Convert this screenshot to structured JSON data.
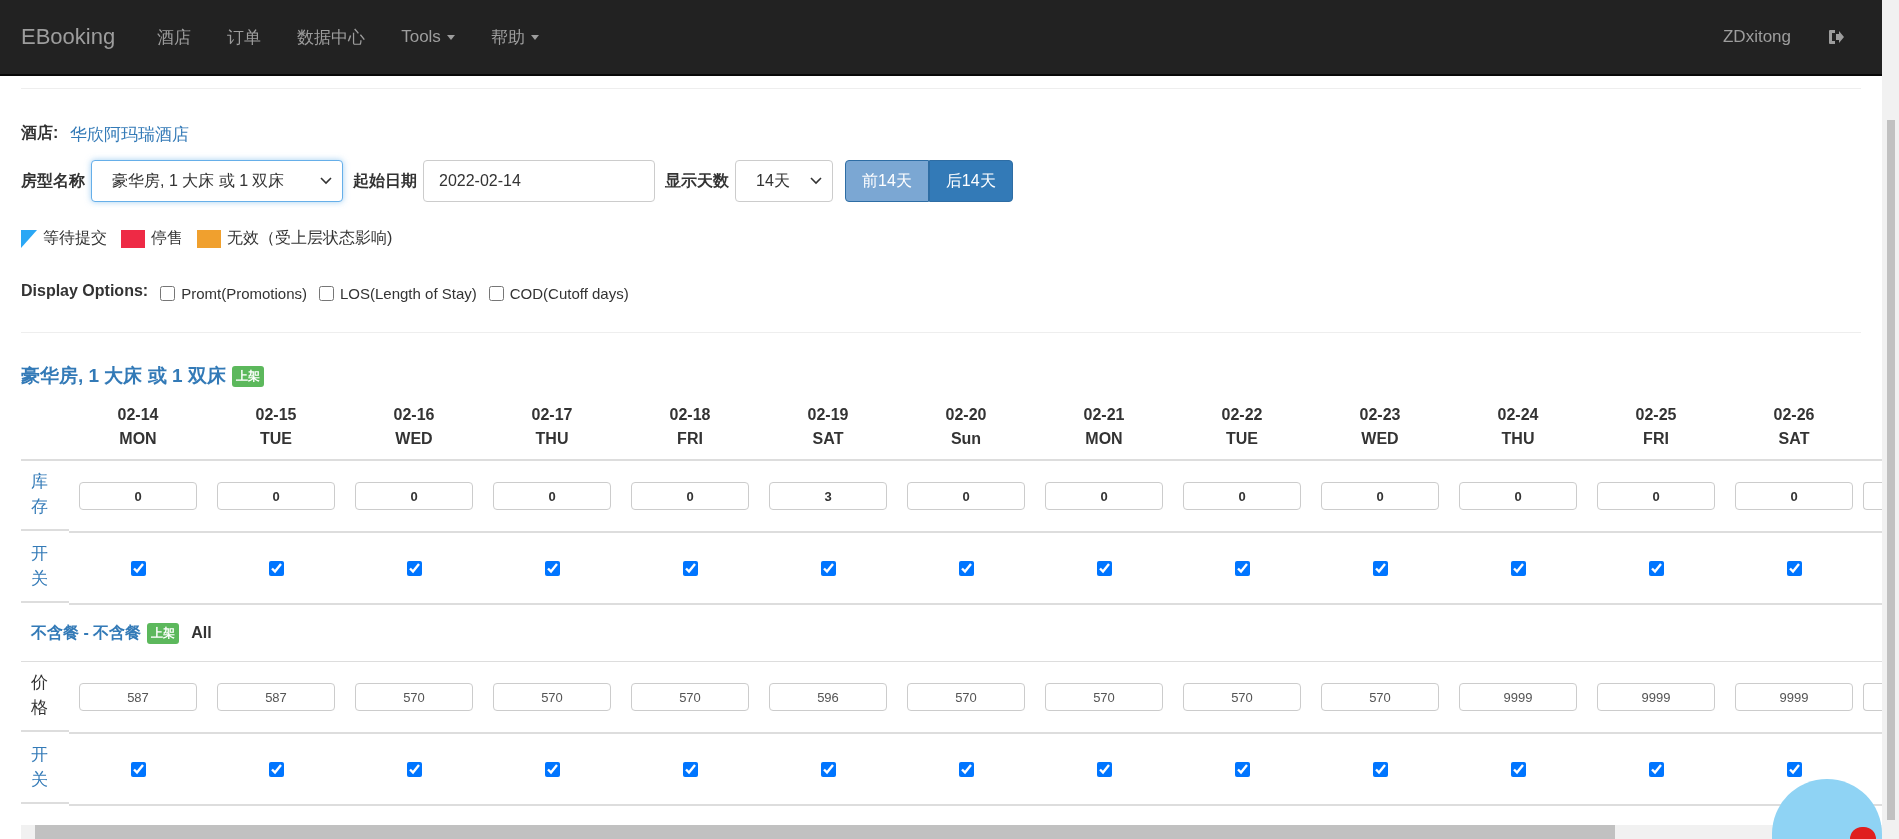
{
  "navbar": {
    "brand": "EBooking",
    "items": [
      {
        "label": "酒店",
        "dropdown": false
      },
      {
        "label": "订单",
        "dropdown": false
      },
      {
        "label": "数据中心",
        "dropdown": false
      },
      {
        "label": "Tools",
        "dropdown": true
      },
      {
        "label": "帮助",
        "dropdown": true
      }
    ],
    "user": "ZDxitong"
  },
  "hotel": {
    "label": "酒店:",
    "name": "华欣阿玛瑞酒店"
  },
  "filters": {
    "room_type": {
      "label": "房型名称",
      "value": "豪华房, 1 大床 或 1 双床"
    },
    "start_date": {
      "label": "起始日期",
      "value": "2022-02-14"
    },
    "days": {
      "label": "显示天数",
      "value": "14天"
    },
    "buttons": [
      {
        "label": "前14天",
        "disabled": true
      },
      {
        "label": "后14天",
        "disabled": false
      }
    ]
  },
  "legend": [
    {
      "kind": "triangle",
      "color": "#2aa7f5",
      "label": "等待提交"
    },
    {
      "kind": "square",
      "color": "#ee2a45",
      "label": "停售"
    },
    {
      "kind": "square",
      "color": "#f0a02e",
      "label": "无效（受上层状态影响)"
    }
  ],
  "display_options": {
    "label": "Display Options:",
    "options": [
      {
        "label": "Promt(Promotions)",
        "checked": false
      },
      {
        "label": "LOS(Length of Stay)",
        "checked": false
      },
      {
        "label": "COD(Cutoff days)",
        "checked": false
      }
    ]
  },
  "room": {
    "name": "豪华房, 1 大床 或 1 双床",
    "status": "上架",
    "dates": [
      {
        "date": "02-14",
        "day": "MON"
      },
      {
        "date": "02-15",
        "day": "TUE"
      },
      {
        "date": "02-16",
        "day": "WED"
      },
      {
        "date": "02-17",
        "day": "THU"
      },
      {
        "date": "02-18",
        "day": "FRI"
      },
      {
        "date": "02-19",
        "day": "SAT"
      },
      {
        "date": "02-20",
        "day": "Sun"
      },
      {
        "date": "02-21",
        "day": "MON"
      },
      {
        "date": "02-22",
        "day": "TUE"
      },
      {
        "date": "02-23",
        "day": "WED"
      },
      {
        "date": "02-24",
        "day": "THU"
      },
      {
        "date": "02-25",
        "day": "FRI"
      },
      {
        "date": "02-26",
        "day": "SAT"
      }
    ],
    "inventory_label": "库存",
    "inventory": [
      "0",
      "0",
      "0",
      "0",
      "0",
      "3",
      "0",
      "0",
      "0",
      "0",
      "0",
      "0",
      "0"
    ],
    "switch_label": "开关",
    "open": [
      true,
      true,
      true,
      true,
      true,
      true,
      true,
      true,
      true,
      true,
      true,
      true,
      true
    ],
    "plans": [
      {
        "name": "不含餐 - 不含餐",
        "status": "上架",
        "scope": "All",
        "price_label": "价格",
        "prices": [
          "587",
          "587",
          "570",
          "570",
          "570",
          "596",
          "570",
          "570",
          "570",
          "570",
          "9999",
          "9999",
          "9999"
        ],
        "switch_label": "开关",
        "open": [
          true,
          true,
          true,
          true,
          true,
          true,
          true,
          true,
          true,
          true,
          true,
          true,
          true
        ]
      }
    ]
  }
}
